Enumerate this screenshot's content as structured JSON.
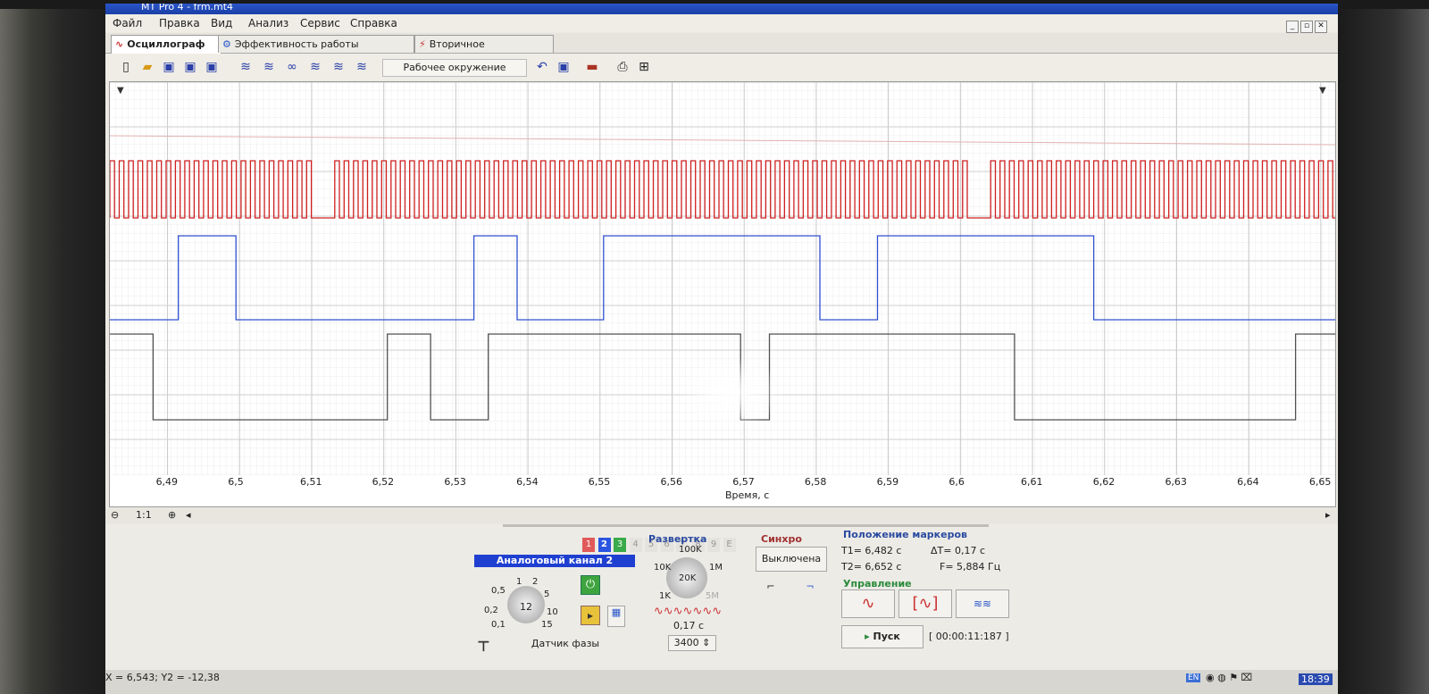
{
  "window": {
    "title": "MT Pro 4 - frm.mt4"
  },
  "menu": {
    "items": [
      "Файл",
      "Правка",
      "Вид",
      "Анализ",
      "Сервис",
      "Справка"
    ]
  },
  "tabs": [
    {
      "label": "Осциллограф",
      "active": true
    },
    {
      "label": "Эффективность работы цилиндров",
      "active": false
    },
    {
      "label": "Вторичное напряжение",
      "active": false
    }
  ],
  "toolbar": {
    "environment": "Рабочее окружение"
  },
  "chart_data": {
    "type": "line",
    "xlabel": "Время, с",
    "xlim": [
      6.482,
      6.652
    ],
    "x_ticks": [
      "6,49",
      "6,5",
      "6,51",
      "6,52",
      "6,53",
      "6,54",
      "6,55",
      "6,56",
      "6,57",
      "6,58",
      "6,59",
      "6,6",
      "6,61",
      "6,62",
      "6,63",
      "6,64",
      "6,65"
    ],
    "series": [
      {
        "color": "#d02020",
        "kind": "pulse-train",
        "gaps": [
          [
            6.5105,
            6.513
          ],
          [
            6.6015,
            6.6035
          ]
        ]
      },
      {
        "color": "#3050d0",
        "kind": "square",
        "edges": [
          [
            6.482,
            0
          ],
          [
            6.4915,
            1
          ],
          [
            6.4995,
            0
          ],
          [
            6.5325,
            1
          ],
          [
            6.5385,
            0
          ],
          [
            6.5505,
            1
          ],
          [
            6.5805,
            0
          ],
          [
            6.5885,
            1
          ],
          [
            6.6185,
            0
          ],
          [
            6.652,
            0
          ]
        ]
      },
      {
        "color": "#505050",
        "kind": "square",
        "edges": [
          [
            6.482,
            1
          ],
          [
            6.488,
            0
          ],
          [
            6.5205,
            1
          ],
          [
            6.5265,
            0
          ],
          [
            6.5345,
            1
          ],
          [
            6.5695,
            0
          ],
          [
            6.5735,
            1
          ],
          [
            6.6075,
            0
          ],
          [
            6.6465,
            1
          ],
          [
            6.652,
            1
          ]
        ]
      }
    ]
  },
  "zoom": {
    "ratio": "1:1"
  },
  "channels": {
    "numbers": [
      "1",
      "2",
      "3",
      "4",
      "5",
      "6",
      "7",
      "8",
      "9",
      "E"
    ],
    "active_label": "Аналоговый канал 2",
    "scale_labels": [
      "0,5",
      "1",
      "2",
      "5",
      "10",
      "15",
      "0,2",
      "0,1"
    ],
    "scale_center": "12",
    "sensor": "Датчик фазы"
  },
  "sweep": {
    "title": "Развертка",
    "labels": [
      "100K",
      "10K",
      "1M",
      "1K",
      "5M"
    ],
    "center": "20K",
    "time": "0,17 с",
    "samples": "3400"
  },
  "sync": {
    "title": "Синхро",
    "mode": "Выключена"
  },
  "markers": {
    "title": "Положение маркеров",
    "t1": "T1= 6,482 с",
    "dt": "ΔT= 0,17 с",
    "t2": "T2= 6,652 с",
    "freq": "F= 5,884 Гц"
  },
  "control": {
    "title": "Управление",
    "start": "Пуск",
    "timer": "[ 00:00:11:187 ]"
  },
  "status": {
    "coords": "X = 6,543; Y2 = -12,38",
    "lang": "EN",
    "clock": "18:39"
  }
}
